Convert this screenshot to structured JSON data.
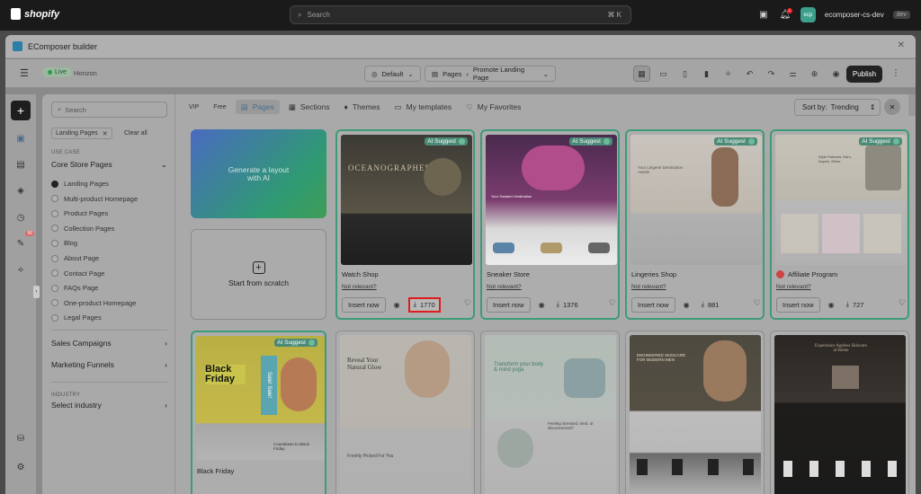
{
  "shopify": {
    "logo_text": "shopify",
    "search_placeholder": "Search",
    "search_shortcut": "⌘  K",
    "notif_count": "1",
    "store_initials": "ecp",
    "store_name": "ecomposer-cs-dev",
    "store_tag": "dev"
  },
  "modal": {
    "title": "EComposer builder"
  },
  "builder": {
    "live_label": "Live",
    "theme_name": "Horizon",
    "default_label": "Default",
    "pages_label": "Pages",
    "page_name": "Promote Landing Page",
    "publish_label": "Publish"
  },
  "rail": {
    "badge_count": "56"
  },
  "sidebar": {
    "search_placeholder": "Search",
    "chip_label": "Landing Pages",
    "clear_all": "Clear all",
    "use_case_label": "USE CASE",
    "core_group": "Core Store Pages",
    "items": [
      {
        "label": "Landing Pages",
        "selected": true
      },
      {
        "label": "Multi-product Homepage",
        "selected": false
      },
      {
        "label": "Product Pages",
        "selected": false
      },
      {
        "label": "Collection Pages",
        "selected": false
      },
      {
        "label": "Blog",
        "selected": false
      },
      {
        "label": "About Page",
        "selected": false
      },
      {
        "label": "Contact Page",
        "selected": false
      },
      {
        "label": "FAQs Page",
        "selected": false
      },
      {
        "label": "One-product Homepage",
        "selected": false
      },
      {
        "label": "Legal Pages",
        "selected": false
      }
    ],
    "sales_campaigns": "Sales Campaigns",
    "marketing_funnels": "Marketing Funnels",
    "industry_label": "INDUSTRY",
    "select_industry": "Select industry"
  },
  "tabs": {
    "vip": "VIP",
    "free": "Free",
    "pages": "Pages",
    "sections": "Sections",
    "themes": "Themes",
    "my_templates": "My templates",
    "my_favorites": "My Favorites"
  },
  "sort": {
    "label": "Sort by:",
    "value": "Trending"
  },
  "ai_card": {
    "text": "Generate a layout with AI"
  },
  "scratch": {
    "label": "Start from scratch"
  },
  "common": {
    "ai_suggest": "AI Suggest",
    "not_relevant": "Not relevant?",
    "insert_now": "Insert now"
  },
  "cards": [
    {
      "name": "Watch Shop",
      "downloads": "1770",
      "thumb_text": "OCEANOGRAPHER"
    },
    {
      "name": "Sneaker Store",
      "downloads": "1376",
      "thumb_text": "Your Sneaker Destination"
    },
    {
      "name": "Lingeries Shop",
      "downloads": "881",
      "thumb_text": "Your Lingerie Destination Awaits"
    },
    {
      "name": "Affiliate Program",
      "downloads": "727",
      "thumb_text": "Style Partners: Earn, Inspire, Shine"
    },
    {
      "name": "Black Friday",
      "thumb_text": "Black Friday"
    },
    {
      "name": "",
      "thumb_text": "Reveal Your Natural Glow"
    },
    {
      "name": "",
      "thumb_text": "Transform your body & mind yoga"
    },
    {
      "name": "",
      "thumb_text": "ENGINEERED SKINCARE FOR MODERN MEN"
    },
    {
      "name": "",
      "thumb_text": "Experience Ageless Skincare at Home"
    }
  ],
  "card_sub_texts": {
    "black_friday_badge": "Sale! Sale!",
    "black_friday_countdown": "Countdown to Black Friday",
    "skin_sub": "Freshly Picked For You",
    "yoga_sub": "Feeling stressed, tired, or disconnected?"
  }
}
